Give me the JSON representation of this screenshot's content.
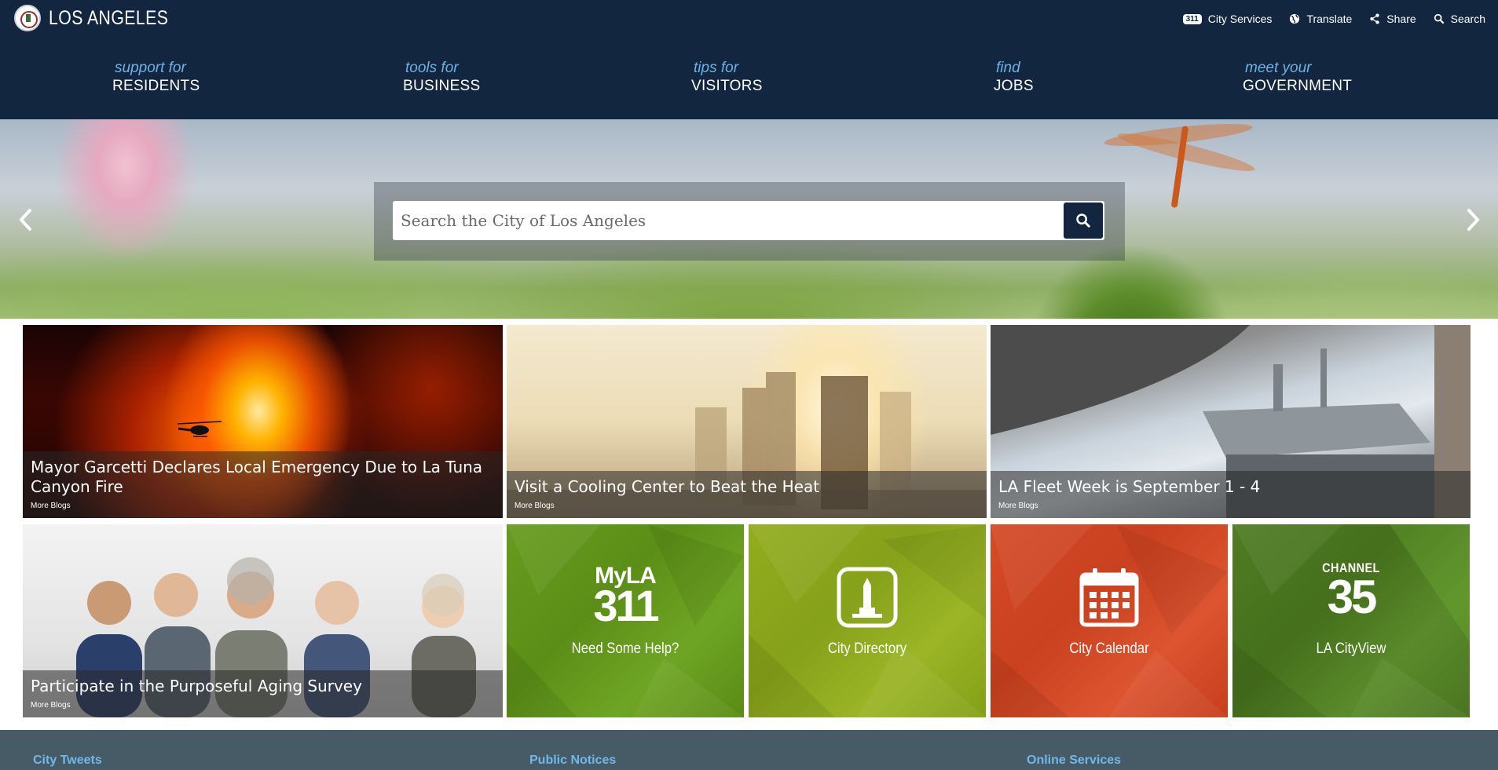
{
  "site": {
    "title": "LOS ANGELES"
  },
  "utility_nav": {
    "badge": "311",
    "city_services": "City Services",
    "translate": "Translate",
    "share": "Share",
    "search": "Search"
  },
  "main_nav": [
    {
      "sub": "support for",
      "main": "RESIDENTS"
    },
    {
      "sub": "tools for",
      "main": "BUSINESS"
    },
    {
      "sub": "tips for",
      "main": "VISITORS"
    },
    {
      "sub": "find",
      "main": "JOBS"
    },
    {
      "sub": "meet your",
      "main": "GOVERNMENT"
    }
  ],
  "hero": {
    "search_placeholder": "Search the City of Los Angeles"
  },
  "blog_tiles": [
    {
      "title": "Mayor Garcetti Declares Local Emergency Due to La Tuna Canyon Fire",
      "more": "More Blogs"
    },
    {
      "title": "Visit a Cooling Center to Beat the Heat",
      "more": "More Blogs"
    },
    {
      "title": "LA Fleet Week is September 1 - 4",
      "more": "More Blogs"
    },
    {
      "title": "Participate in the Purposeful Aging Survey",
      "more": "More Blogs"
    }
  ],
  "service_tiles": [
    {
      "logo_top": "MyLA",
      "logo_bottom": "311",
      "label": "Need Some Help?",
      "color": "#679b1e",
      "icon": "myla311-logo"
    },
    {
      "label": "City Directory",
      "color": "#93ad1f",
      "icon": "city-hall-icon"
    },
    {
      "label": "City Calendar",
      "color": "#d64a27",
      "icon": "calendar-icon"
    },
    {
      "logo_top": "CHANNEL",
      "logo_bottom": "35",
      "label": "LA CityView",
      "color": "#4f7d22",
      "icon": "channel35-logo"
    }
  ],
  "footer": {
    "col1": "City Tweets",
    "col2": "Public Notices",
    "col3": "Online Services"
  },
  "colors": {
    "header_bg": "#12273f",
    "nav_sub": "#6fb1e6",
    "footer_bg": "#475b66",
    "footer_heading": "#6fb9ea"
  }
}
